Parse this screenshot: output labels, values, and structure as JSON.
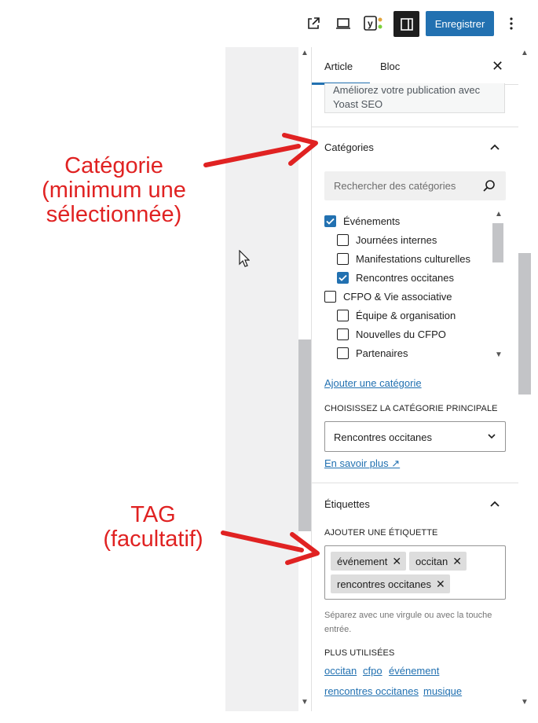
{
  "toolbar": {
    "external_icon": "external-link-icon",
    "device_icon": "laptop-icon",
    "yoast_icon": "yoast-icon",
    "sidebar_icon": "sidebar-toggle-icon",
    "save_label": "Enregistrer",
    "more_icon": "more-vertical-icon",
    "colors": {
      "save_bg": "#2271b1",
      "sidebar_bg": "#1e1e1e"
    }
  },
  "sidebar": {
    "tabs": [
      {
        "label": "Article",
        "active": true
      },
      {
        "label": "Bloc",
        "active": false
      }
    ],
    "yoast_prompt": "Améliorez votre publication avec Yoast SEO",
    "categories": {
      "title": "Catégories",
      "search_placeholder": "Rechercher des catégories",
      "items": [
        {
          "label": "Événements",
          "checked": true
        },
        {
          "label": "Journées internes",
          "checked": false
        },
        {
          "label": "Manifestations culturelles",
          "checked": false
        },
        {
          "label": "Rencontres occitanes",
          "checked": true
        },
        {
          "label": "CFPO & Vie associative",
          "checked": false
        },
        {
          "label": "Équipe & organisation",
          "checked": false
        },
        {
          "label": "Nouvelles du CFPO",
          "checked": false
        },
        {
          "label": "Partenaires",
          "checked": false
        }
      ],
      "add_link": "Ajouter une catégorie",
      "primary_label": "Choisissez la catégorie principale",
      "primary_value": "Rencontres occitanes",
      "learn_more": "En savoir plus ↗"
    },
    "tags": {
      "title": "Étiquettes",
      "add_label": "Ajouter une étiquette",
      "items": [
        "événement",
        "occitan",
        "rencontres occitanes"
      ],
      "help": "Séparez avec une virgule ou avec la touche entrée.",
      "most_used_label": "Plus utilisées",
      "most_used": [
        "occitan",
        "cfpo",
        "événement",
        "rencontres occitanes",
        "musique"
      ]
    }
  },
  "annotations": {
    "category_lines": [
      "Catégorie",
      "(minimum une",
      "sélectionnée)"
    ],
    "tag_lines": [
      "TAG",
      "(facultatif)"
    ],
    "color": "#e02222"
  }
}
